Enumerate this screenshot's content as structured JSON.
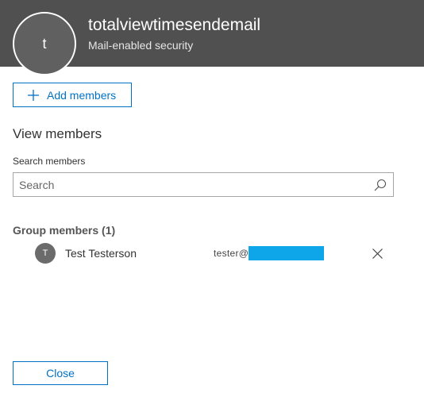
{
  "header": {
    "avatar_initial": "t",
    "group_name": "totalviewtimesendemail",
    "group_type": "Mail-enabled security"
  },
  "actions": {
    "add_members_label": "Add members",
    "close_label": "Close"
  },
  "view_members": {
    "title": "View members",
    "search_label": "Search members",
    "search_placeholder": "Search",
    "search_value": ""
  },
  "group_members": {
    "title": "Group members (1)",
    "members": [
      {
        "initial": "T",
        "name": "Test Testerson",
        "email_prefix": "tester@"
      }
    ]
  },
  "colors": {
    "header_bg": "#505050",
    "accent": "#0072c6",
    "redaction": "#0ea5e9"
  }
}
